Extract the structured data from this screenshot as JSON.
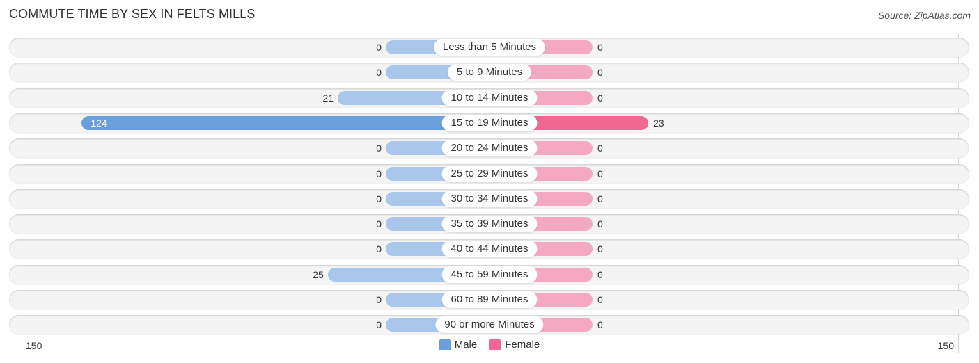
{
  "header": {
    "title": "COMMUTE TIME BY SEX IN FELTS MILLS",
    "source": "Source: ZipAtlas.com"
  },
  "colors": {
    "male": "#6a9fdb",
    "male_light": "#a9c7ea",
    "female": "#f06892",
    "female_light": "#f5a8c2"
  },
  "chart_data": {
    "type": "bar",
    "orientation": "horizontal-diverging",
    "title": "COMMUTE TIME BY SEX IN FELTS MILLS",
    "categories": [
      "Less than 5 Minutes",
      "5 to 9 Minutes",
      "10 to 14 Minutes",
      "15 to 19 Minutes",
      "20 to 24 Minutes",
      "25 to 29 Minutes",
      "30 to 34 Minutes",
      "35 to 39 Minutes",
      "40 to 44 Minutes",
      "45 to 59 Minutes",
      "60 to 89 Minutes",
      "90 or more Minutes"
    ],
    "series": [
      {
        "name": "Male",
        "values": [
          0,
          0,
          21,
          124,
          0,
          0,
          0,
          0,
          0,
          25,
          0,
          0
        ]
      },
      {
        "name": "Female",
        "values": [
          0,
          0,
          0,
          23,
          0,
          0,
          0,
          0,
          0,
          0,
          0,
          0
        ]
      }
    ],
    "axis": {
      "min_label": "150",
      "max_label": "150",
      "range": [
        -150,
        150
      ]
    },
    "legend": {
      "entries": [
        "Male",
        "Female"
      ],
      "placement": "bottom-center"
    },
    "grid": false
  }
}
